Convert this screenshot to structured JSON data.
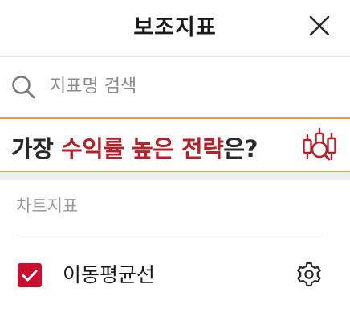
{
  "header": {
    "title": "보조지표",
    "close_icon": "close-icon"
  },
  "search": {
    "placeholder": "지표명 검색",
    "value": "",
    "icon": "search-icon"
  },
  "banner": {
    "text_part1": "가장 ",
    "text_accent": "수익률 높은 전략",
    "text_part2": "은?",
    "icon": "strategy-chart-icon",
    "accent_color": "#b3212a",
    "border_color": "#d1a82f"
  },
  "section": {
    "title": "차트지표",
    "items": [
      {
        "label": "이동평균선",
        "checked": true,
        "settings_icon": "gear-icon"
      }
    ]
  },
  "colors": {
    "checkbox": "#c8102e",
    "text_primary": "#1a1a1a",
    "text_secondary": "#9a9a9a"
  }
}
